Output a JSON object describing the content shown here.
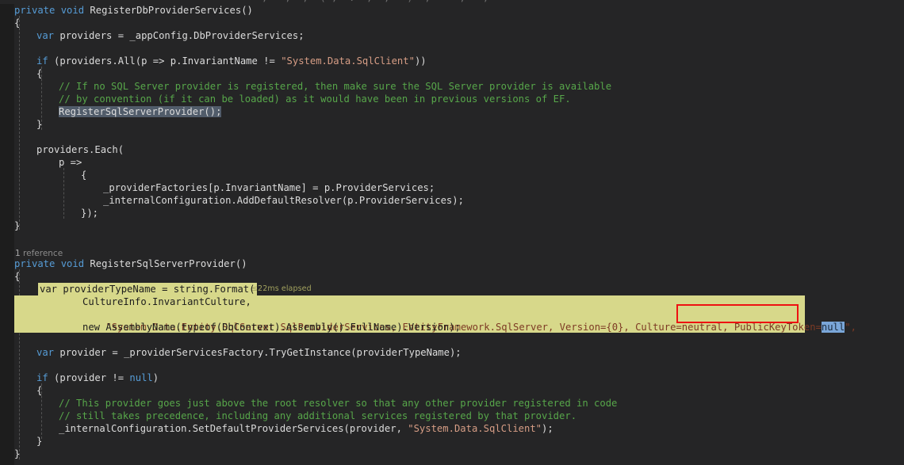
{
  "app": {
    "kind": "code-editor",
    "language": "csharp",
    "theme": "dark",
    "colors": {
      "background": "#252526",
      "gutter": "#1d1d1d",
      "keyword": "#569cd6",
      "string": "#d69d85",
      "comment": "#57a64a",
      "plain": "#dcdcdc",
      "selection": "#515c6a",
      "highlight_band": "#d7d88a",
      "blue_selection": "#7aa6d8",
      "annotation_box": "#ee1111",
      "elapsed_text": "#a2a25e",
      "codelens_text": "#8c8c8c"
    }
  },
  "top_sliver": {
    "text": "; - ,  ;  ( ;  .  ;  ,   )  ,  -  ,   ;"
  },
  "codelens": {
    "count": "1",
    "label": "reference"
  },
  "annotations": {
    "elapsed": "≤22ms elapsed",
    "red_box_target": "PublicKeyToken=null\"",
    "blue_selection_text": "null"
  },
  "code_lines": [
    {
      "indent": 0,
      "tokens": [
        {
          "t": "kw",
          "v": "private"
        },
        {
          "t": "pln",
          "v": " "
        },
        {
          "t": "kw",
          "v": "void"
        },
        {
          "t": "pln",
          "v": " RegisterDbProviderServices()"
        }
      ]
    },
    {
      "indent": 0,
      "tokens": [
        {
          "t": "pln",
          "v": "{"
        }
      ]
    },
    {
      "indent": 1,
      "tokens": [
        {
          "t": "kw",
          "v": "var"
        },
        {
          "t": "pln",
          "v": " providers = _appConfig.DbProviderServices;"
        }
      ]
    },
    {
      "indent": 0,
      "tokens": [
        {
          "t": "pln",
          "v": ""
        }
      ]
    },
    {
      "indent": 1,
      "tokens": [
        {
          "t": "kw",
          "v": "if"
        },
        {
          "t": "pln",
          "v": " (providers.All(p => p.InvariantName != "
        },
        {
          "t": "str",
          "v": "\"System.Data.SqlClient\""
        },
        {
          "t": "pln",
          "v": "))"
        }
      ]
    },
    {
      "indent": 1,
      "tokens": [
        {
          "t": "pln",
          "v": "{"
        }
      ]
    },
    {
      "indent": 2,
      "tokens": [
        {
          "t": "cmt",
          "v": "// If no SQL Server provider is registered, then make sure the SQL Server provider is available"
        }
      ]
    },
    {
      "indent": 2,
      "tokens": [
        {
          "t": "cmt",
          "v": "// by convention (if it can be loaded) as it would have been in previous versions of EF."
        }
      ]
    },
    {
      "indent": 2,
      "tokens": [
        {
          "t": "sel",
          "v": "RegisterSqlServerProvider();"
        }
      ]
    },
    {
      "indent": 1,
      "tokens": [
        {
          "t": "pln",
          "v": "}"
        }
      ]
    },
    {
      "indent": 0,
      "tokens": [
        {
          "t": "pln",
          "v": ""
        }
      ]
    },
    {
      "indent": 1,
      "tokens": [
        {
          "t": "pln",
          "v": "providers.Each("
        }
      ]
    },
    {
      "indent": 2,
      "tokens": [
        {
          "t": "pln",
          "v": "p =>"
        }
      ]
    },
    {
      "indent": 3,
      "tokens": [
        {
          "t": "pln",
          "v": "{"
        }
      ]
    },
    {
      "indent": 4,
      "tokens": [
        {
          "t": "pln",
          "v": "_providerFactories[p.InvariantName] = p.ProviderServices;"
        }
      ]
    },
    {
      "indent": 4,
      "tokens": [
        {
          "t": "pln",
          "v": "_internalConfiguration.AddDefaultResolver(p.ProviderServices);"
        }
      ]
    },
    {
      "indent": 3,
      "tokens": [
        {
          "t": "pln",
          "v": "});"
        }
      ]
    },
    {
      "indent": 0,
      "tokens": [
        {
          "t": "pln",
          "v": "}"
        }
      ]
    },
    {
      "indent": 0,
      "tokens": [
        {
          "t": "pln",
          "v": ""
        }
      ]
    },
    {
      "indent": 0,
      "tokens": [
        {
          "t": "pln",
          "v": ""
        }
      ]
    },
    {
      "indent": 0,
      "tokens": [
        {
          "t": "kw",
          "v": "private"
        },
        {
          "t": "pln",
          "v": " "
        },
        {
          "t": "kw",
          "v": "void"
        },
        {
          "t": "pln",
          "v": " RegisterSqlServerProvider()"
        }
      ]
    },
    {
      "indent": 0,
      "tokens": [
        {
          "t": "pln",
          "v": "{"
        }
      ]
    },
    {
      "indent": 1,
      "tokens": [
        {
          "t": "hl",
          "v": "var providerTypeName = string.Format("
        }
      ]
    },
    {
      "indent": 3,
      "tokens": [
        {
          "t": "hl",
          "v": "CultureInfo.InvariantCulture,"
        }
      ]
    },
    {
      "indent": 3,
      "tokens": [
        {
          "t": "hl",
          "v": "\"System.Data.Entity.SqlServer.SqlProviderServices, EntityFramework.SqlServer, Version={0}, Culture=neutral, PublicKeyToken=null\","
        }
      ]
    },
    {
      "indent": 3,
      "tokens": [
        {
          "t": "hl",
          "v": "new AssemblyName(typeof(DbContext).Assembly().FullName).Version);"
        }
      ]
    },
    {
      "indent": 0,
      "tokens": [
        {
          "t": "pln",
          "v": ""
        }
      ]
    },
    {
      "indent": 1,
      "tokens": [
        {
          "t": "kw",
          "v": "var"
        },
        {
          "t": "pln",
          "v": " provider = _providerServicesFactory.TryGetInstance(providerTypeName);"
        }
      ]
    },
    {
      "indent": 0,
      "tokens": [
        {
          "t": "pln",
          "v": ""
        }
      ]
    },
    {
      "indent": 1,
      "tokens": [
        {
          "t": "kw",
          "v": "if"
        },
        {
          "t": "pln",
          "v": " (provider != "
        },
        {
          "t": "kw",
          "v": "null"
        },
        {
          "t": "pln",
          "v": ")"
        }
      ]
    },
    {
      "indent": 1,
      "tokens": [
        {
          "t": "pln",
          "v": "{"
        }
      ]
    },
    {
      "indent": 2,
      "tokens": [
        {
          "t": "cmt",
          "v": "// This provider goes just above the root resolver so that any other provider registered in code"
        }
      ]
    },
    {
      "indent": 2,
      "tokens": [
        {
          "t": "cmt",
          "v": "// still takes precedence, including any additional services registered by that provider."
        }
      ]
    },
    {
      "indent": 2,
      "tokens": [
        {
          "t": "pln",
          "v": "_internalConfiguration.SetDefaultProviderServices(provider, "
        },
        {
          "t": "str",
          "v": "\"System.Data.SqlClient\""
        },
        {
          "t": "pln",
          "v": ");"
        }
      ]
    },
    {
      "indent": 1,
      "tokens": [
        {
          "t": "pln",
          "v": "}"
        }
      ]
    },
    {
      "indent": 0,
      "tokens": [
        {
          "t": "pln",
          "v": "}"
        }
      ]
    }
  ],
  "highlight_block": {
    "line1": "var providerTypeName = string.Format(",
    "line2": "CultureInfo.InvariantCulture,",
    "line3_a": "\"System.Data.Entity.SqlServer.SqlProviderServices, EntityFramework.SqlServer, Version={0}, Culture=neutral, ",
    "line3_b": "PublicKeyToken=",
    "line3_c": "null",
    "line3_d": "\",",
    "line4": "new AssemblyName(typeof(DbContext).Assembly().FullName).Version);"
  }
}
